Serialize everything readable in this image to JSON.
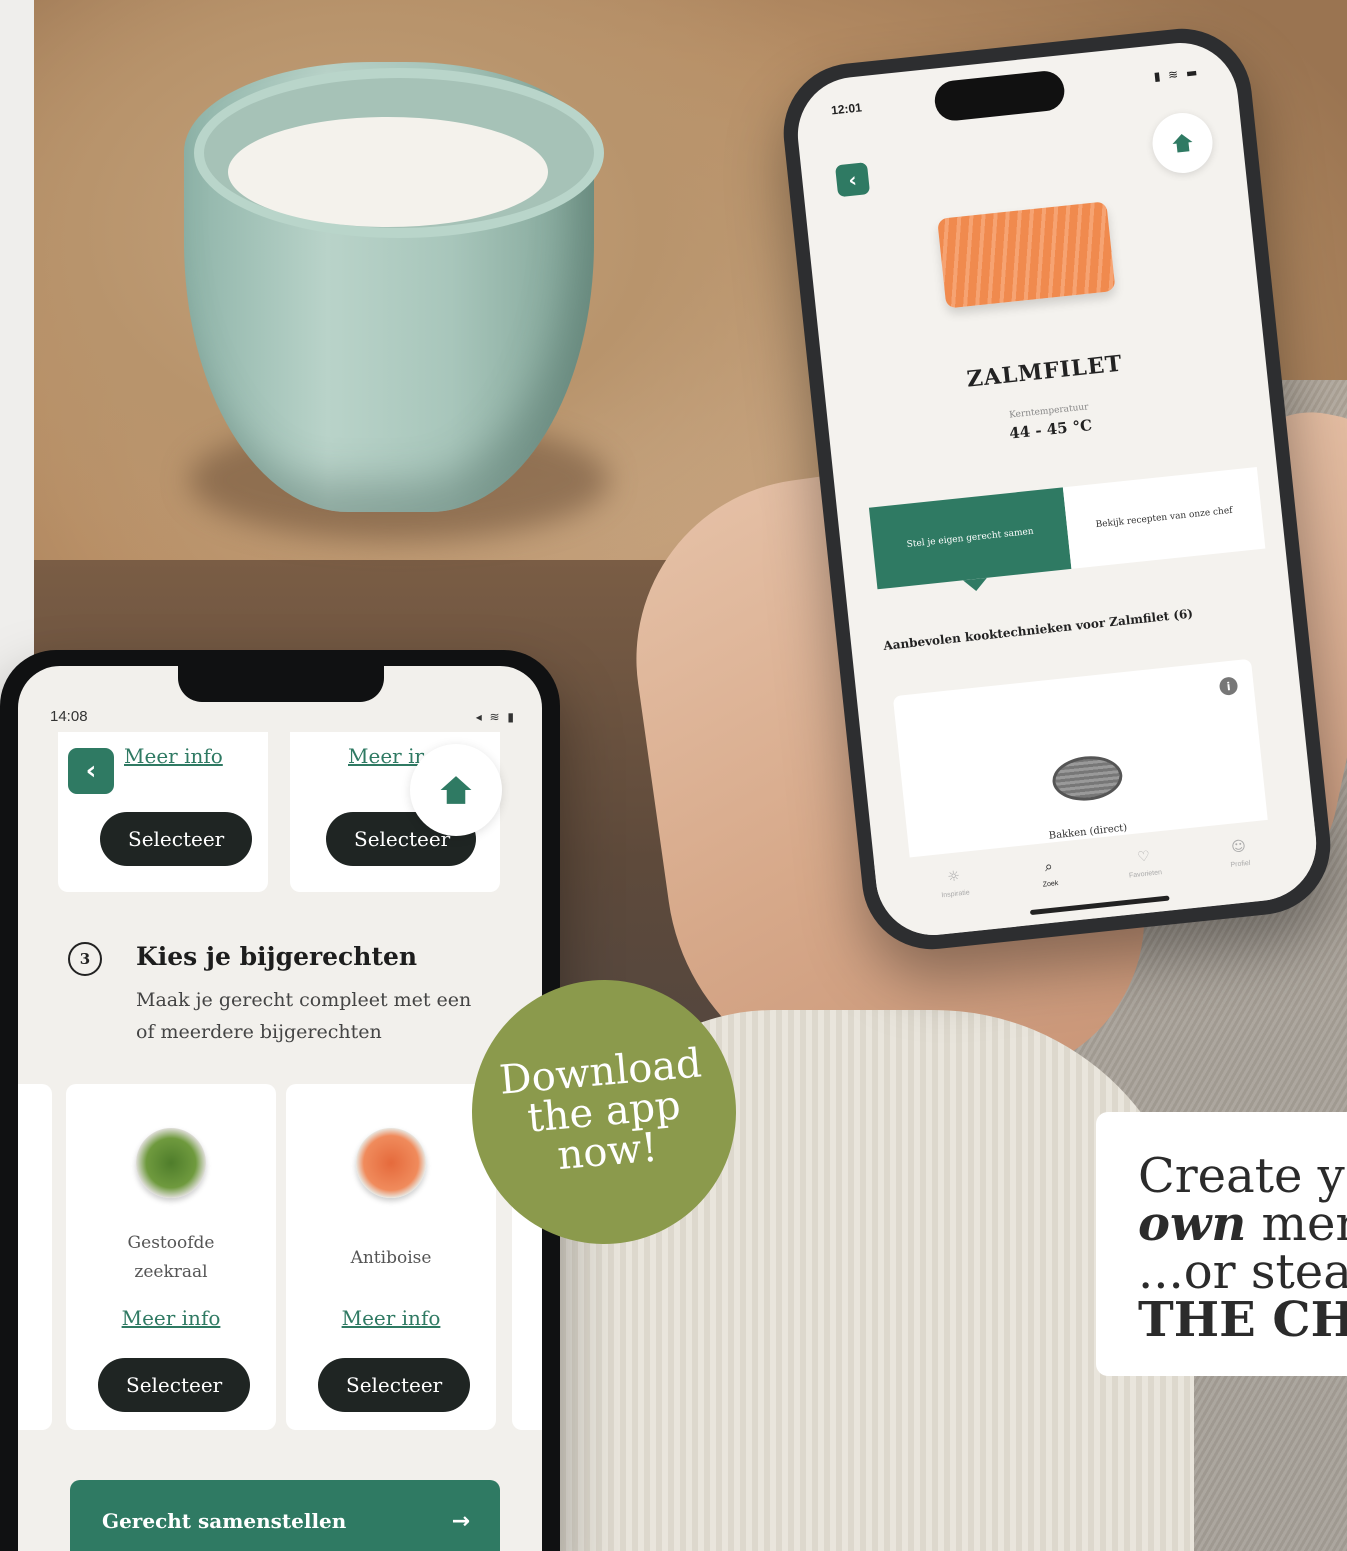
{
  "right_phone": {
    "time": "12:01",
    "status_icons": "▮ ≋ ▬",
    "title": "ZALMFILET",
    "temp_label": "Kerntemperatuur",
    "temp_value": "44 - 45 °C",
    "tabs": [
      {
        "label": "Stel je eigen gerecht samen",
        "active": true
      },
      {
        "label": "Bekijk recepten van onze chef",
        "active": false
      }
    ],
    "section_title": "Aanbevolen kooktechnieken voor Zalmfilet (6)",
    "technique": "Bakken (direct)",
    "info_icon": "i",
    "tabbar": [
      {
        "icon": "lightbulb-icon",
        "glyph": "☼",
        "label": "Inspiratie"
      },
      {
        "icon": "search-icon",
        "glyph": "⌕",
        "label": "Zoek"
      },
      {
        "icon": "heart-icon",
        "glyph": "♡",
        "label": "Favorieten"
      },
      {
        "icon": "user-icon",
        "glyph": "☺",
        "label": "Profiel"
      }
    ]
  },
  "left_phone": {
    "time": "14:08",
    "status_icons": "◂ ≋ ▮",
    "top_cards": [
      {
        "link": "Meer info",
        "button": "Selecteer"
      },
      {
        "link": "Meer ir",
        "button": "Selecteer"
      }
    ],
    "step": {
      "number": "3",
      "title": "Kies je bijgerechten",
      "description": "Maak je gerecht compleet met een of meerdere bijgerechten"
    },
    "sides": [
      {
        "name": "Gestoofde zeekraal",
        "link": "Meer info",
        "button": "Selecteer"
      },
      {
        "name": "Antiboise",
        "link": "Meer info",
        "button": "Selecteer"
      }
    ],
    "cta": {
      "label": "Gerecht samenstellen",
      "arrow": "→"
    }
  },
  "badge": {
    "line1": "Download",
    "line2": "the app",
    "line3": "now!"
  },
  "promo": {
    "line1": "Create y",
    "line2_bold": "own",
    "line2_rest": " mer",
    "line3": "...or steal",
    "line4": "THE CHI"
  },
  "colors": {
    "brand_green": "#2f7a63",
    "badge_olive": "#8b9a4c",
    "button_dark": "#1f2523"
  }
}
